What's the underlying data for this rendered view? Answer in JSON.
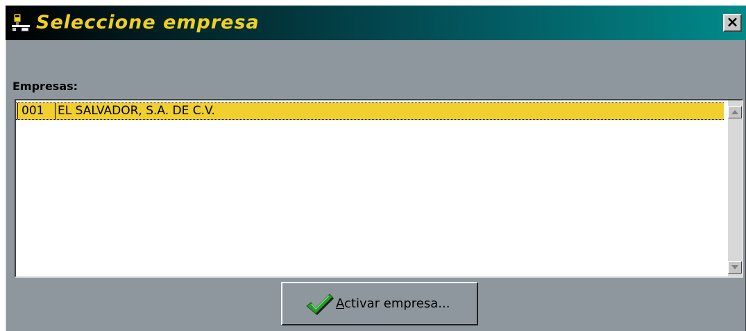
{
  "window": {
    "title": "Seleccione empresa",
    "close_label": "×"
  },
  "list": {
    "label": "Empresas:",
    "items": [
      {
        "code": "001",
        "name": "EL SALVADOR, S.A. DE C.V.",
        "selected": true
      }
    ]
  },
  "actions": {
    "activate_mnemonic": "A",
    "activate_rest": "ctivar empresa..."
  },
  "colors": {
    "title_text": "#f0d020",
    "selection": "#f0cf2e",
    "window_bg": "#8e979e",
    "check": "#2a9a2a"
  },
  "icons": {
    "app": "server-network-icon",
    "close": "close-icon",
    "scroll_up": "arrow-up-icon",
    "scroll_down": "arrow-down-icon",
    "activate": "checkmark-icon"
  }
}
